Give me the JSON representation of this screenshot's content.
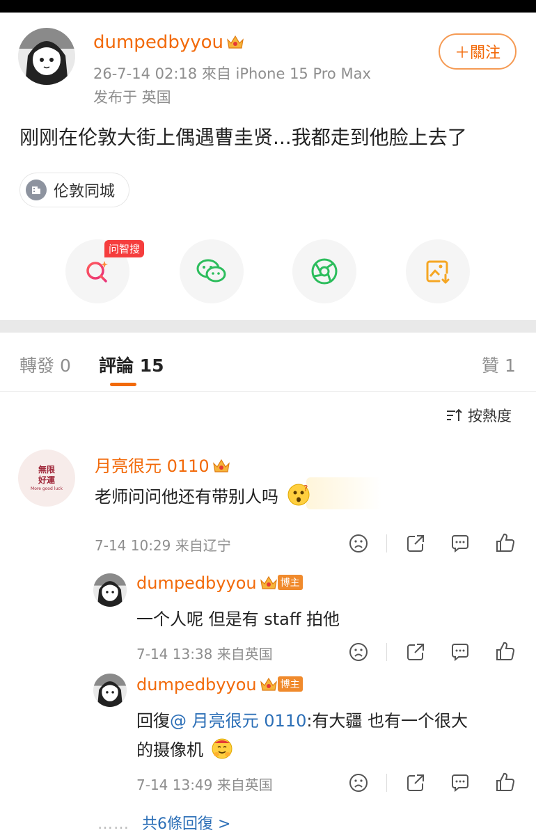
{
  "post": {
    "username": "dumpedbyyou",
    "meta_line1": "26-7-14 02:18  來自 iPhone 15 Pro Max",
    "meta_line2": "发布于 英国",
    "follow_label": "＋關注",
    "text": "刚刚在伦敦大街上偶遇曹圭贤...我都走到他脸上去了",
    "topic": "伦敦同城"
  },
  "share": {
    "ask_badge": "问智搜",
    "items": [
      "ai-search-icon",
      "wechat-icon",
      "moments-icon",
      "save-image-icon"
    ]
  },
  "tabs": {
    "repost": "轉發 0",
    "comments": "評論 15",
    "likes": "贊 1"
  },
  "sort_label": "按熱度",
  "comments": [
    {
      "username": "月亮很元 0110",
      "text": "老师问问他还有带别人吗",
      "time": "7-14 10:29 来自辽宁",
      "avatar_text_1": "無限",
      "avatar_text_2": "好運",
      "avatar_text_3": "More good luck"
    }
  ],
  "replies": [
    {
      "username": "dumpedbyyou",
      "badge": "博主",
      "text": "一个人呢 但是有 staff 拍他",
      "time": "7-14 13:38 来自英国"
    },
    {
      "username": "dumpedbyyou",
      "badge": "博主",
      "prefix": "回復",
      "mention": "@ 月亮很元 0110",
      "text_line1": ":有大疆 也有一个很大",
      "text_line2": "的摄像机",
      "time": "7-14 13:49 来自英国"
    }
  ],
  "more_replies": "共6條回復 >",
  "more_dots": "……",
  "colors": {
    "accent": "#f26a0a",
    "link": "#2c6fb7",
    "meta": "#8e8e8e"
  }
}
